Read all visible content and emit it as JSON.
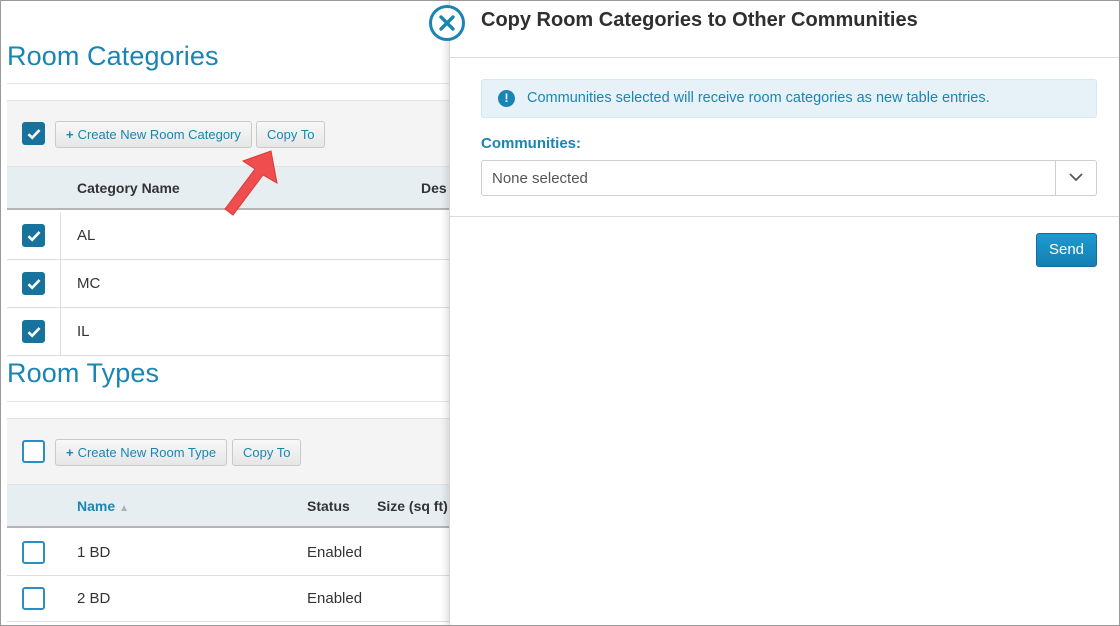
{
  "room_categories": {
    "title": "Room Categories",
    "create_button": "Create New Room Category",
    "copy_button": "Copy To",
    "columns": [
      "Category Name",
      "Des"
    ],
    "rows": [
      {
        "name": "AL",
        "checked": true
      },
      {
        "name": "MC",
        "checked": true
      },
      {
        "name": "IL",
        "checked": true
      }
    ]
  },
  "room_types": {
    "title": "Room Types",
    "create_button": "Create New Room Type",
    "copy_button": "Copy To",
    "columns": {
      "name": "Name",
      "status": "Status",
      "size": "Size (sq ft)"
    },
    "rows": [
      {
        "name": "1 BD",
        "status": "Enabled",
        "checked": false
      },
      {
        "name": "2 BD",
        "status": "Enabled",
        "checked": false
      }
    ]
  },
  "modal": {
    "title": "Copy Room Categories to Other Communities",
    "alert": "Communities selected will receive room categories as new table entries.",
    "field_label": "Communities:",
    "select_value": "None selected",
    "send_button": "Send"
  },
  "colors": {
    "accent": "#1a85b4",
    "checkbox_checked": "#17729c",
    "arrow": "#f04e4e"
  }
}
